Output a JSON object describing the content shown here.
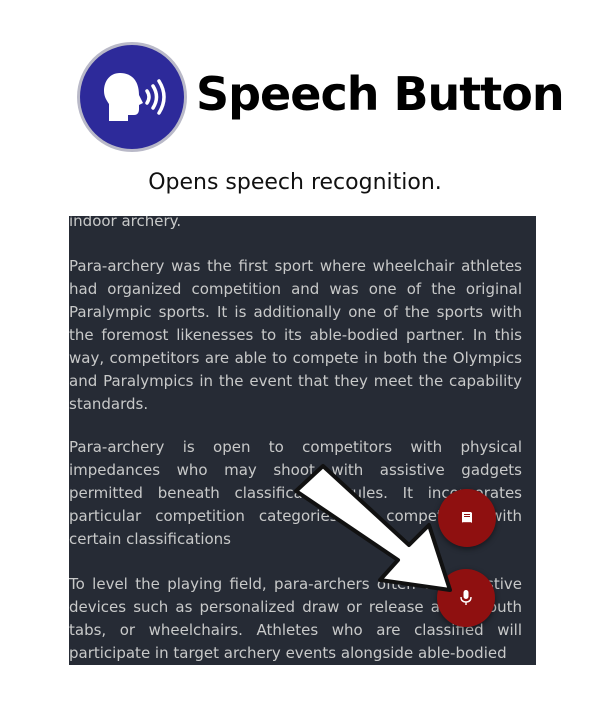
{
  "header": {
    "title": "Speech Button",
    "subtitle": "Opens speech recognition.",
    "logo_color": "#2d2a9a"
  },
  "article": {
    "paragraphs": [
      "indoor archery.",
      "Para-archery was the first sport where wheelchair athletes had organized competition and was one of the original Paralympic sports. It is additionally one of the sports with the foremost likenesses to its able-bodied partner. In this way, competitors are able to compete in both the Olympics and Paralympics in the event that they meet the capability standards.",
      "Para-archery is open to competitors with physical impedances who may shoot with assistive gadgets permitted beneath classification rules. It incorporates particular competition categories for competitors with certain classifications",
      "To level the playing field, para-archers often use assistive devices such as personalized draw or release aids, mouth tabs, or wheelchairs. Athletes who are classified will participate in target archery events alongside able-bodied"
    ],
    "background": "#262b35",
    "text_color": "#c8c9c9"
  },
  "buttons": {
    "reader": {
      "icon": "book-icon",
      "color": "#8f1010"
    },
    "speech": {
      "icon": "microphone-icon",
      "color": "#8f1010"
    }
  },
  "annotation": {
    "icon": "arrow-pointer-icon"
  }
}
